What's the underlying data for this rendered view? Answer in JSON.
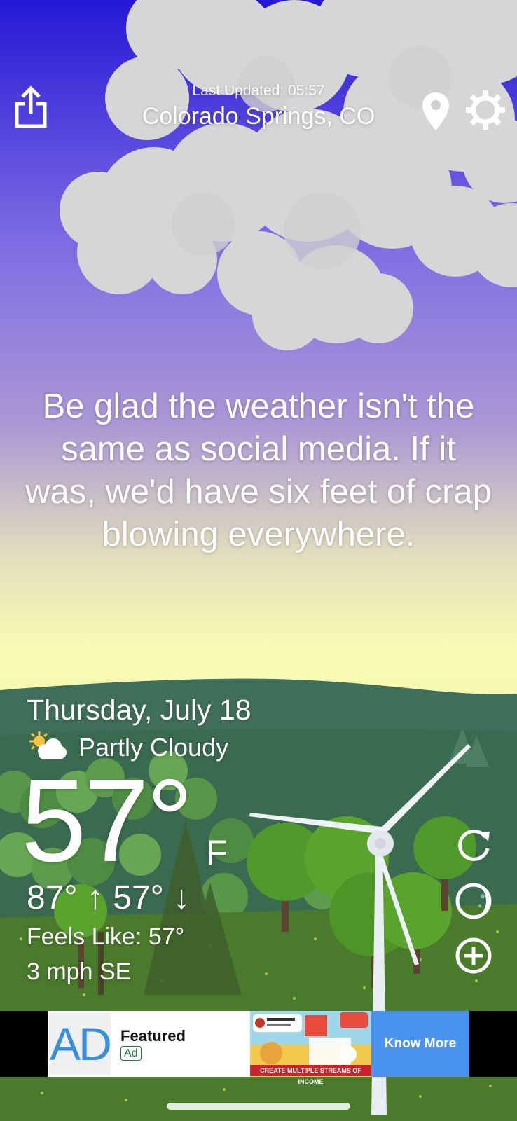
{
  "header": {
    "last_updated": "Last Updated: 05:57",
    "location": "Colorado Springs, CO",
    "share_icon": "share-icon",
    "pin_icon": "location-pin-icon",
    "settings_icon": "gear-icon"
  },
  "quote": "Be glad the weather isn't the same as social media. If it was, we'd have six feet of crap blowing everywhere.",
  "weather": {
    "date": "Thursday, July 18",
    "condition": "Partly Cloudy",
    "condition_icon": "partly-cloudy-icon",
    "temperature": "57°",
    "unit": "F",
    "high_low": "87° ↑ 57° ↓",
    "feels_like": "Feels Like: 57°",
    "wind": "3 mph SE"
  },
  "actions": {
    "refresh_icon": "refresh-icon",
    "moon_icon": "moon-icon",
    "add_icon": "add-circle-icon"
  },
  "ad": {
    "logo": "AD",
    "title": "Featured",
    "tag": "Ad",
    "image_caption": "CREATE MULTIPLE STREAMS OF INCOME",
    "cta": "Know More"
  },
  "colors": {
    "sky_top": "#2a1fd6",
    "sky_mid": "#9a86d8",
    "sky_horizon": "#f9fbb4",
    "hills_back": "#3f6e5a",
    "grass": "#4a7a2c",
    "cloud": "#d9d9d9",
    "ad_cta": "#4a94f0"
  }
}
